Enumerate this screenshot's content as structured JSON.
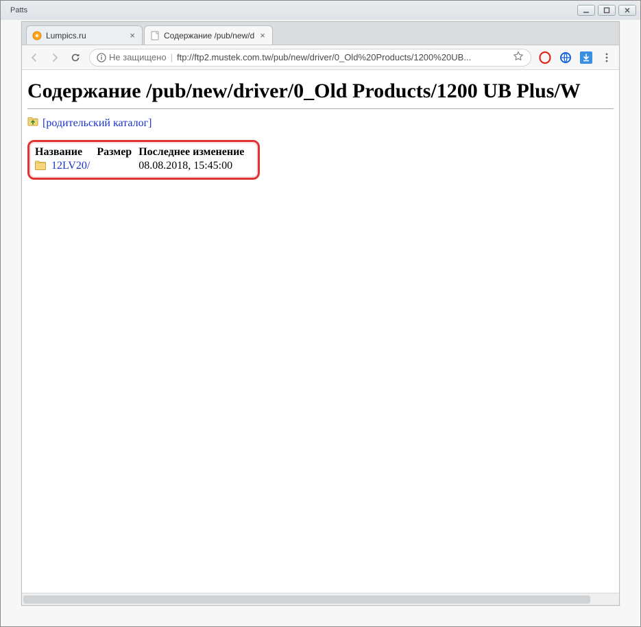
{
  "window": {
    "title_left": "Patts"
  },
  "tabs": [
    {
      "title": "Lumpics.ru",
      "favicon": "orange-dot"
    },
    {
      "title": "Содержание /pub/new/d",
      "favicon": "page"
    }
  ],
  "active_tab_index": 1,
  "address_bar": {
    "security_label": "Не защищено",
    "url": "ftp://ftp2.mustek.com.tw/pub/new/driver/0_Old%20Products/1200%20UB..."
  },
  "page": {
    "heading": "Содержание /pub/new/driver/0_Old Products/1200 UB Plus/W",
    "parent_link": "[родительский каталог]",
    "columns": {
      "name": "Название",
      "size": "Размер",
      "modified": "Последнее изменение"
    },
    "rows": [
      {
        "name": "12LV20/",
        "size": "",
        "modified": "08.08.2018, 15:45:00"
      }
    ]
  }
}
